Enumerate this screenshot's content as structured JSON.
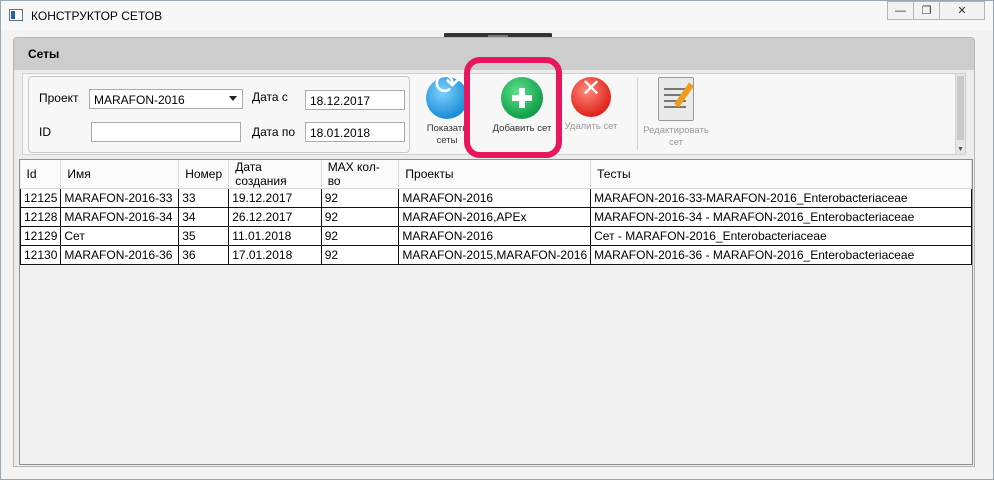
{
  "window": {
    "title": "КОНСТРУКТОР СЕТОВ",
    "buttons": [
      "—",
      "❐",
      "✕"
    ]
  },
  "panel": {
    "title": "Сеты"
  },
  "filters": {
    "project_label": "Проект",
    "project_value": "MARAFON-2016",
    "id_label": "ID",
    "id_value": "",
    "date_from_label": "Дата с",
    "date_from_value": "18.12.2017",
    "date_to_label": "Дата по",
    "date_to_value": "18.01.2018"
  },
  "toolbar": {
    "show_label": "Показать сеты",
    "add_label": "Добавить сет",
    "delete_label": "Удалить сет",
    "edit_label": "Редактировать сет"
  },
  "table": {
    "columns": [
      "Id",
      "Имя",
      "Номер",
      "Дата создания",
      "MAX кол-во",
      "Проекты",
      "Тесты"
    ],
    "rows": [
      [
        "12125",
        "MARAFON-2016-33",
        "33",
        "19.12.2017",
        "92",
        "MARAFON-2016",
        "MARAFON-2016-33-MARAFON-2016_Enterobacteriaceae"
      ],
      [
        "12128",
        "MARAFON-2016-34",
        "34",
        "26.12.2017",
        "92",
        "MARAFON-2016,APEx",
        "MARAFON-2016-34 - MARAFON-2016_Enterobacteriaceae"
      ],
      [
        "12129",
        "Сет",
        "35",
        "11.01.2018",
        "92",
        "MARAFON-2016",
        "Сет  - MARAFON-2016_Enterobacteriaceae"
      ],
      [
        "12130",
        "MARAFON-2016-36",
        "36",
        "17.01.2018",
        "92",
        "MARAFON-2015,MARAFON-2016",
        "MARAFON-2016-36 - MARAFON-2016_Enterobacteriaceae"
      ]
    ]
  }
}
